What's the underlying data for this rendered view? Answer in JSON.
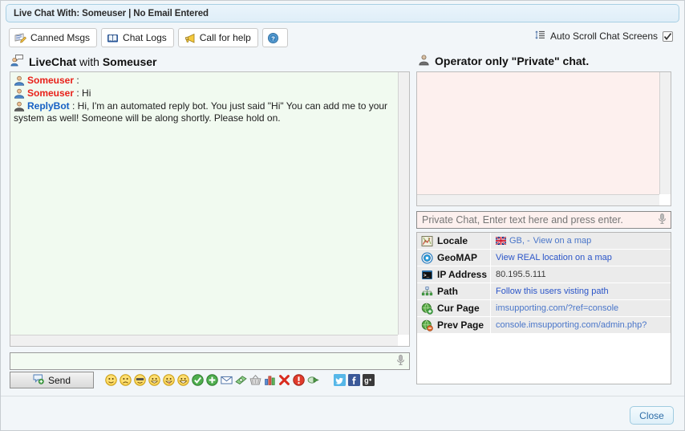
{
  "window": {
    "title": "Live Chat With: Someuser | No Email Entered",
    "close_label": "Close"
  },
  "toolbar": {
    "canned_msgs": "Canned Msgs",
    "chat_logs": "Chat Logs",
    "call_for_help": "Call for help",
    "help_label": "",
    "auto_scroll_label": "Auto Scroll Chat Screens",
    "auto_scroll_checked": true
  },
  "left": {
    "heading_prefix": "LiveChat",
    "heading_mid": " with ",
    "heading_name": "Someuser",
    "messages": [
      {
        "author": "Someuser",
        "role": "visitor",
        "text": ""
      },
      {
        "author": "Someuser",
        "role": "visitor",
        "text": "Hi"
      },
      {
        "author": "ReplyBot",
        "role": "bot",
        "text": "Hi, I'm an automated reply bot. You just said \"Hi\" You can add me to your system as well! Someone will be along shortly. Please hold on."
      }
    ],
    "input_value": "",
    "input_placeholder": "",
    "send_label": "Send",
    "emoticons": [
      "smile-icon",
      "sad-icon",
      "cool-icon",
      "grin-icon",
      "tongue-icon",
      "laugh-icon",
      "check-green-icon",
      "plus-green-icon",
      "envelope-icon",
      "money-icon",
      "basket-icon",
      "chart-icon",
      "red-x-icon",
      "exclamation-icon",
      "forward-arrow-icon"
    ],
    "social": [
      "twitter-icon",
      "facebook-icon",
      "googleplus-icon"
    ]
  },
  "right": {
    "heading": "Operator only \"Private\" chat.",
    "private_value": "",
    "private_placeholder": "Private Chat, Enter text here and press enter.",
    "info_rows": [
      {
        "icon": "locale-icon",
        "label": "Locale",
        "value": "GB, - ",
        "link": "View on a map",
        "flag": true,
        "style": "soft"
      },
      {
        "icon": "geomap-icon",
        "label": "GeoMAP",
        "value": "",
        "link": "View REAL location on a map",
        "flag": false,
        "style": "link"
      },
      {
        "icon": "terminal-icon",
        "label": "IP Address",
        "value": "80.195.5.111",
        "link": "",
        "flag": false,
        "style": "plain"
      },
      {
        "icon": "path-icon",
        "label": "Path",
        "value": "",
        "link": "Follow this users visting path",
        "flag": false,
        "style": "link"
      },
      {
        "icon": "curpage-icon",
        "label": "Cur Page",
        "value": "imsupporting.com/?ref=console",
        "link": "",
        "flag": false,
        "style": "soft"
      },
      {
        "icon": "prevpage-icon",
        "label": "Prev Page",
        "value": "console.imsupporting.com/admin.php?",
        "link": "",
        "flag": false,
        "style": "soft"
      }
    ]
  },
  "colors": {
    "title_bg": "#e4f0f8",
    "chat_bg": "#f1faf0",
    "private_bg": "#fdf0ee",
    "visitor_name": "#e8211a",
    "bot_name": "#1560c4",
    "link": "#2b55c8",
    "close_text": "#2f6ea8"
  }
}
